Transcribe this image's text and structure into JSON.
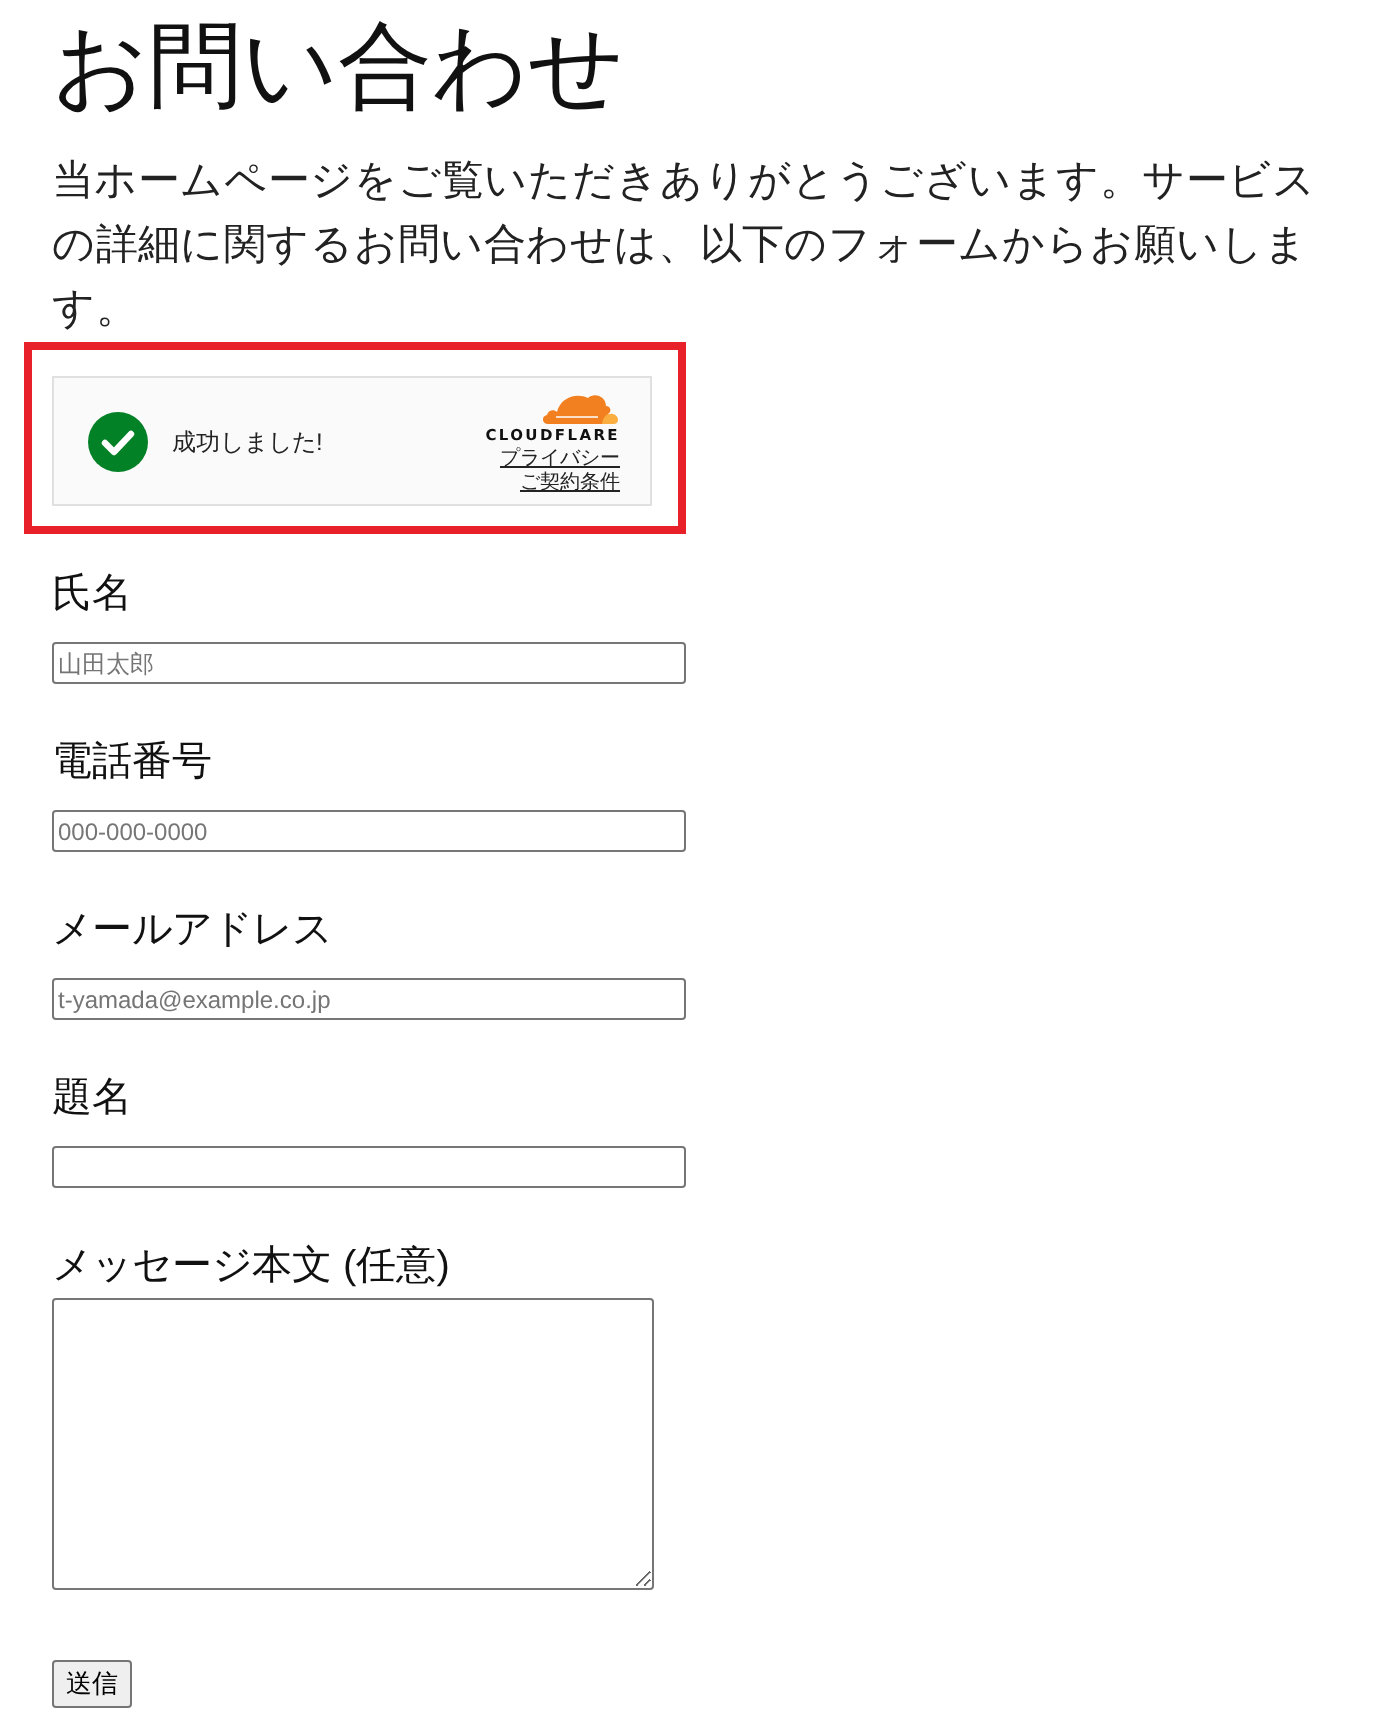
{
  "page": {
    "title": "お問い合わせ",
    "intro": "当ホームページをご覧いただきありがとうございます。サービスの詳細に関するお問い合わせは、以下のフォームからお願いします。"
  },
  "captcha": {
    "highlighted": true,
    "verified": true,
    "status": "成功しました!",
    "brand": "CLOUDFLARE",
    "links": [
      "プライバシー",
      "ご契約条件"
    ]
  },
  "fields": [
    {
      "kind": "input",
      "label": "氏名",
      "placeholder": "山田太郎"
    },
    {
      "kind": "input",
      "label": "電話番号",
      "placeholder": "000-000-0000"
    },
    {
      "kind": "input",
      "label": "メールアドレス",
      "placeholder": "t-yamada@example.co.jp"
    },
    {
      "kind": "input",
      "label": "題名"
    },
    {
      "kind": "textarea",
      "label": "メッセージ本文 (任意)"
    }
  ],
  "submit": "送信"
}
